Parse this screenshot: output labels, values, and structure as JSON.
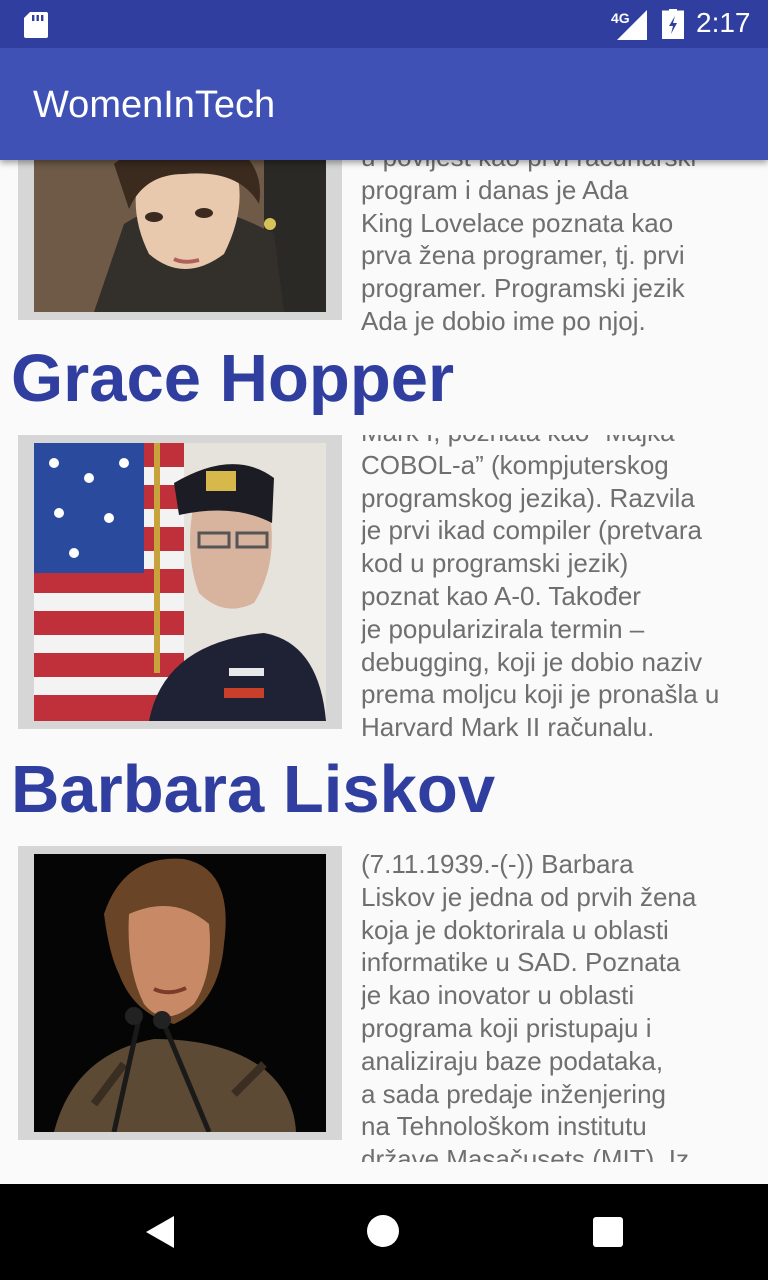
{
  "status_bar": {
    "network": "4G",
    "time": "2:17",
    "icons": [
      "sd-card-icon",
      "signal-icon",
      "battery-charging-icon"
    ]
  },
  "app_bar": {
    "title": "WomenInTech"
  },
  "entries": [
    {
      "name": "",
      "photo_icon": "ada-lovelace-portrait",
      "bio_lines": [
        "u povijest kao prvi računarski",
        "program i danas je Ada",
        "King Lovelace poznata kao",
        "prva žena programer, tj. prvi",
        "programer. Programski jezik",
        "Ada je dobio ime po njoj."
      ]
    },
    {
      "name": "Grace Hopper",
      "photo_icon": "grace-hopper-portrait",
      "bio_lines": [
        "Mark I, poznata kao “Majka",
        "COBOL-a” (kompjuterskog",
        "programskog jezika). Razvila",
        "je prvi ikad compiler (pretvara",
        "kod u programski jezik)",
        "poznat kao A-0. Također",
        "je popularizirala termin –",
        "debugging, koji je dobio naziv",
        "prema moljcu koji je pronašla u",
        "Harvard Mark II računalu."
      ]
    },
    {
      "name": "Barbara Liskov",
      "photo_icon": "barbara-liskov-portrait",
      "bio_lines": [
        "(7.11.1939.-(-)) Barbara",
        "Liskov je jedna od prvih žena",
        "koja je doktorirala u oblasti",
        "informatike u SAD. Poznata",
        "je kao inovator u oblasti",
        "programa koji pristupaju i",
        "analiziraju baze podataka,",
        "a sada predaje inženjering",
        "na Tehnološkom institutu",
        "države Masačusets (MIT). Iz"
      ]
    }
  ],
  "nav_bar": {
    "buttons": [
      "back-icon",
      "home-icon",
      "recents-icon"
    ]
  }
}
